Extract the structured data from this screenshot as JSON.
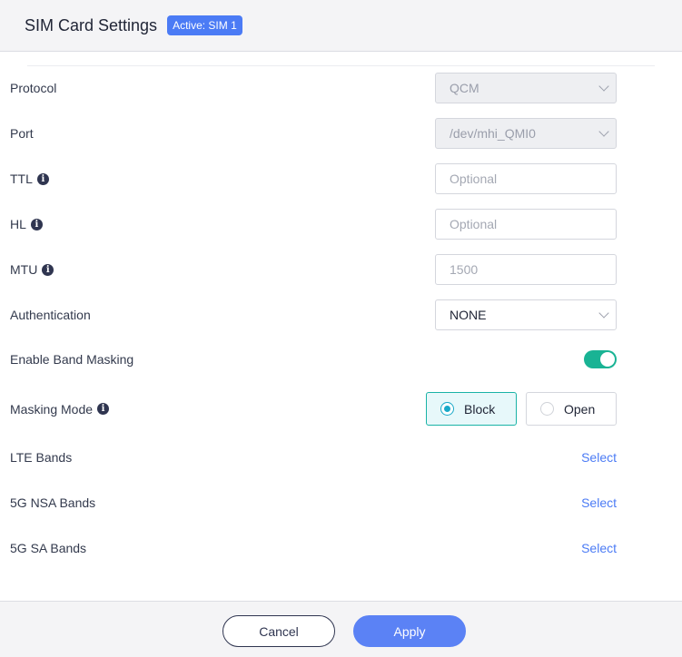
{
  "header": {
    "title": "SIM Card Settings",
    "badge": "Active: SIM 1"
  },
  "form": {
    "protocol": {
      "label": "Protocol",
      "value": "QCM",
      "disabled": true
    },
    "port": {
      "label": "Port",
      "value": "/dev/mhi_QMI0",
      "disabled": true
    },
    "ttl": {
      "label": "TTL",
      "placeholder": "Optional",
      "value": ""
    },
    "hl": {
      "label": "HL",
      "placeholder": "Optional",
      "value": ""
    },
    "mtu": {
      "label": "MTU",
      "placeholder": "1500",
      "value": ""
    },
    "authentication": {
      "label": "Authentication",
      "value": "NONE"
    },
    "band_masking": {
      "label": "Enable Band Masking",
      "enabled": true
    },
    "masking_mode": {
      "label": "Masking Mode",
      "options": [
        "Block",
        "Open"
      ],
      "selected": "Block"
    },
    "lte_bands": {
      "label": "LTE Bands",
      "action": "Select"
    },
    "nsa_bands": {
      "label": "5G NSA Bands",
      "action": "Select"
    },
    "sa_bands": {
      "label": "5G SA Bands",
      "action": "Select"
    }
  },
  "footer": {
    "cancel_label": "Cancel",
    "apply_label": "Apply"
  },
  "colors": {
    "accent_blue": "#4b7bf5",
    "toggle_on": "#19b394",
    "radio_selected": "#1aa9c8"
  },
  "icons": {
    "info": "info-icon",
    "chevron": "chevron-down-icon"
  }
}
